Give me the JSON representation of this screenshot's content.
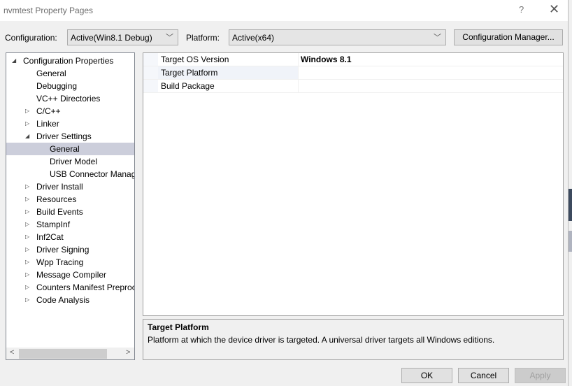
{
  "window": {
    "title": "nvmtest Property Pages",
    "help_label": "?",
    "close_icon": "close-icon"
  },
  "toolbar": {
    "configuration_label": "Configuration:",
    "configuration_value": "Active(Win8.1 Debug)",
    "platform_label": "Platform:",
    "platform_value": "Active(x64)",
    "config_manager_label": "Configuration Manager..."
  },
  "tree": {
    "items": [
      {
        "label": "Configuration Properties",
        "level": 0,
        "expander": "expanded"
      },
      {
        "label": "General",
        "level": 1,
        "expander": "none"
      },
      {
        "label": "Debugging",
        "level": 1,
        "expander": "none"
      },
      {
        "label": "VC++ Directories",
        "level": 1,
        "expander": "none"
      },
      {
        "label": "C/C++",
        "level": 1,
        "expander": "collapsed"
      },
      {
        "label": "Linker",
        "level": 1,
        "expander": "collapsed"
      },
      {
        "label": "Driver Settings",
        "level": 1,
        "expander": "expanded"
      },
      {
        "label": "General",
        "level": 2,
        "expander": "none",
        "selected": true
      },
      {
        "label": "Driver Model",
        "level": 2,
        "expander": "none"
      },
      {
        "label": "USB Connector Manag",
        "level": 2,
        "expander": "none"
      },
      {
        "label": "Driver Install",
        "level": 1,
        "expander": "collapsed"
      },
      {
        "label": "Resources",
        "level": 1,
        "expander": "collapsed"
      },
      {
        "label": "Build Events",
        "level": 1,
        "expander": "collapsed"
      },
      {
        "label": "StampInf",
        "level": 1,
        "expander": "collapsed"
      },
      {
        "label": "Inf2Cat",
        "level": 1,
        "expander": "collapsed"
      },
      {
        "label": "Driver Signing",
        "level": 1,
        "expander": "collapsed"
      },
      {
        "label": "Wpp Tracing",
        "level": 1,
        "expander": "collapsed"
      },
      {
        "label": "Message Compiler",
        "level": 1,
        "expander": "collapsed"
      },
      {
        "label": "Counters Manifest Preproc",
        "level": 1,
        "expander": "collapsed"
      },
      {
        "label": "Code Analysis",
        "level": 1,
        "expander": "collapsed"
      }
    ],
    "scroll_left": "<",
    "scroll_right": ">"
  },
  "grid": {
    "rows": [
      {
        "name": "Target OS Version",
        "value": "Windows 8.1"
      },
      {
        "name": "Target Platform",
        "value": ""
      },
      {
        "name": "Build Package",
        "value": ""
      }
    ],
    "selected_row": "Target Platform"
  },
  "description": {
    "title": "Target Platform",
    "text": "Platform at which the device driver is targeted. A universal driver targets all Windows editions."
  },
  "buttons": {
    "ok": "OK",
    "cancel": "Cancel",
    "apply": "Apply"
  }
}
